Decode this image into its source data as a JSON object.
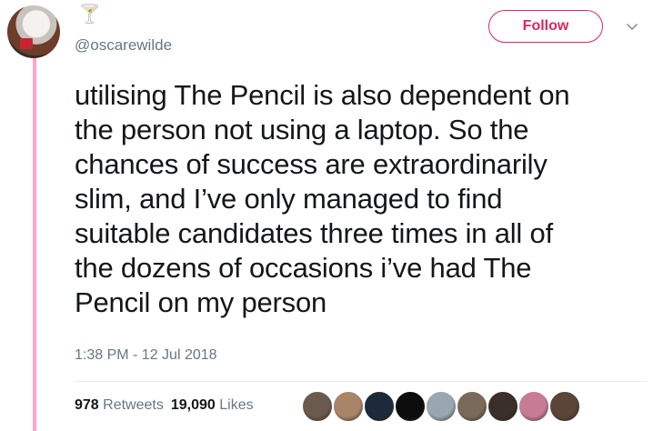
{
  "author": {
    "display_name": "🍸",
    "handle": "@oscarewilde"
  },
  "follow_button": {
    "label": "Follow",
    "color": "#e0245e"
  },
  "tweet": {
    "text": "utilising The Pencil is also dependent on\nthe person not using a laptop. So the\nchances of success are extraordinarily\nslim, and I’ve only managed to find\nsuitable candidates three times in all of\nthe dozens of occasions i’ve had The\nPencil on my person",
    "timestamp": "1:38 PM - 12 Jul 2018"
  },
  "stats": {
    "retweets_count": "978",
    "retweets_label": "Retweets",
    "likes_count": "19,090",
    "likes_label": "Likes"
  },
  "likers": [
    {
      "color": "#6b5a4e"
    },
    {
      "color": "#a88566"
    },
    {
      "color": "#1d2a3a"
    },
    {
      "color": "#0c0c0c"
    },
    {
      "color": "#9aa7b1"
    },
    {
      "color": "#7a6a5a"
    },
    {
      "color": "#3a2f2a"
    },
    {
      "color": "#c77b94"
    },
    {
      "color": "#5a4536"
    }
  ],
  "colors": {
    "thread_line": "#f9a8c8",
    "secondary_text": "#657786"
  }
}
